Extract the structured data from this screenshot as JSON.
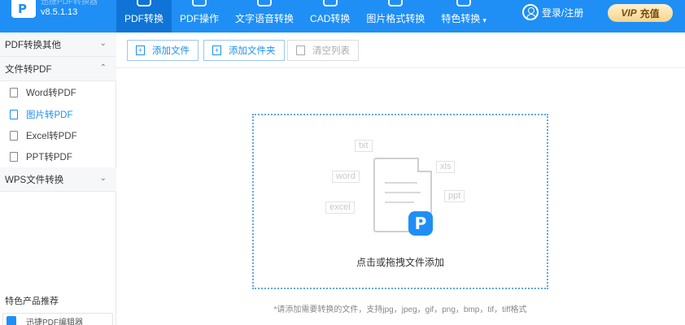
{
  "app": {
    "title": "迅捷PDF转换器",
    "version": "v8.5.1.13",
    "logo_letter": "P"
  },
  "nav": {
    "tabs": [
      {
        "label": "PDF转换",
        "active": true
      },
      {
        "label": "PDF操作",
        "active": false
      },
      {
        "label": "文字语音转换",
        "active": false
      },
      {
        "label": "CAD转换",
        "active": false
      },
      {
        "label": "图片格式转换",
        "active": false
      },
      {
        "label": "特色转换",
        "active": false
      }
    ],
    "caret": "▾"
  },
  "account": {
    "login_label": "登录/注册",
    "vip_prefix": "VIP",
    "vip_label": "充值"
  },
  "sidebar": {
    "groups": [
      {
        "label": "PDF转换其他",
        "chevron": "⌄"
      },
      {
        "label": "文件转PDF",
        "chevron": "⌃"
      },
      {
        "label": "WPS文件转换",
        "chevron": "⌄"
      }
    ],
    "items": [
      {
        "label": "Word转PDF",
        "icon": "word-file-icon",
        "active": false
      },
      {
        "label": "图片转PDF",
        "icon": "image-file-icon",
        "active": true
      },
      {
        "label": "Excel转PDF",
        "icon": "excel-file-icon",
        "active": false
      },
      {
        "label": "PPT转PDF",
        "icon": "ppt-file-icon",
        "active": false
      }
    ],
    "recommend_title": "特色产品推荐",
    "recommend_item": "迅捷PDF编辑器"
  },
  "toolbar": {
    "add_file": "添加文件",
    "add_folder": "添加文件夹",
    "clear_list": "清空列表"
  },
  "dropzone": {
    "tags": [
      "txt",
      "word",
      "xls",
      "ppt",
      "excel"
    ],
    "prompt": "点击或拖拽文件添加",
    "hint": "*请添加需要转换的文件，支持jpg，jpeg，gif，png，bmp，tif，tiff格式"
  },
  "colors": {
    "primary": "#1f8ff5",
    "active_tab": "#0f74d6",
    "vip_gold": "#f3d48a"
  }
}
